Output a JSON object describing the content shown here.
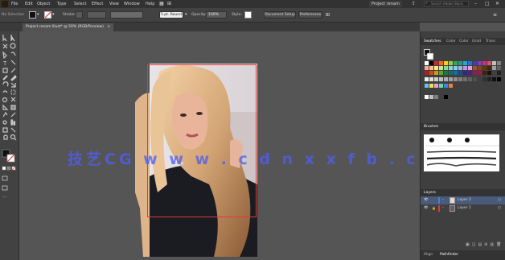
{
  "menubar": {
    "items": [
      "File",
      "Edit",
      "Object",
      "Type",
      "Select",
      "Effect",
      "View",
      "Window",
      "Help"
    ],
    "workspace": "Project renam",
    "search_placeholder": "Search Adobe Stock"
  },
  "controlbar": {
    "selection_label": "No Selection",
    "stroke_label": "Stroke:",
    "brush_label": "5 pt. Round",
    "opacity_label": "Opacity:",
    "opacity_value": "100%",
    "style_label": "Style:",
    "doc_setup": "Document Setup",
    "preferences": "Preferences"
  },
  "tab": {
    "title": "Project renam Illust* @ 50% (RGB/Preview)"
  },
  "panels": {
    "top_tabs": [
      "Swatches",
      "Color",
      "Color",
      "Grad",
      "Trans"
    ],
    "brushes_title": "Brushes",
    "layers_title": "Layers",
    "layers": [
      {
        "name": "Layer 2",
        "selected": true,
        "color": "#4a7bd8"
      },
      {
        "name": "Layer 1",
        "selected": false,
        "color": "#e03a3a"
      }
    ],
    "bottom_tabs": [
      "Align",
      "Pathfinder"
    ]
  },
  "watermark": "技艺CG  w w w . c d n x x f b . c n",
  "colors": {
    "accent_selection": "#e03a3a",
    "layer_highlight": "#4a5a7a"
  }
}
